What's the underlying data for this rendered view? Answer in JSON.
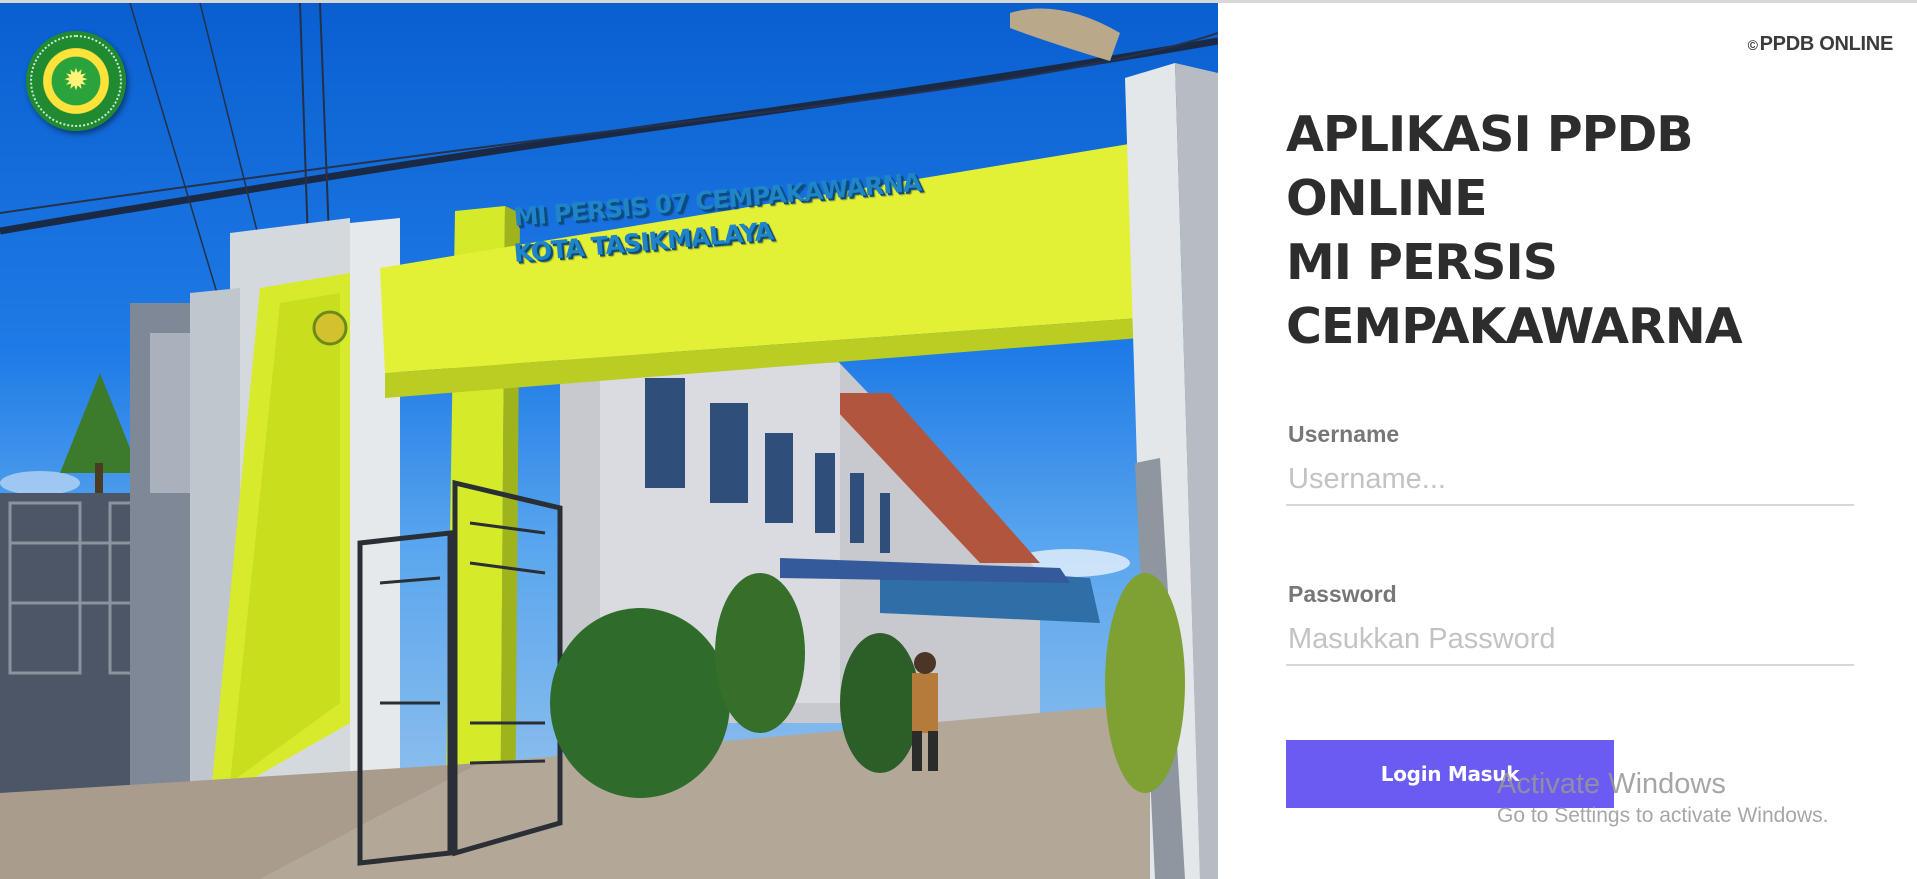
{
  "branding": {
    "logo": "school-emblem",
    "photo_sign_line_1": "MI PERSIS 07 CEMPAKAWARNA",
    "photo_sign_line_2": "KOTA TASIKMALAYA"
  },
  "header": {
    "copyright_symbol": "©",
    "copyright_text": "PPDB ONLINE"
  },
  "title": {
    "line_1": "APLIKASI PPDB",
    "line_2": "ONLINE",
    "line_3": "MI PERSIS",
    "line_4": "CEMPAKAWARNA"
  },
  "form": {
    "username_label": "Username",
    "username_placeholder": "Username...",
    "username_value": "",
    "password_label": "Password",
    "password_placeholder": "Masukkan Password",
    "password_value": "",
    "login_label": "Login Masuk"
  },
  "watermark": {
    "title": "Activate Windows",
    "subtitle": "Go to Settings to activate Windows."
  },
  "colors": {
    "accent": "#6a5cf2",
    "title_text": "#2d2d2d",
    "label_text": "#777777",
    "sky": "#1f7be6",
    "arch_yellow": "#d9ee2a"
  }
}
